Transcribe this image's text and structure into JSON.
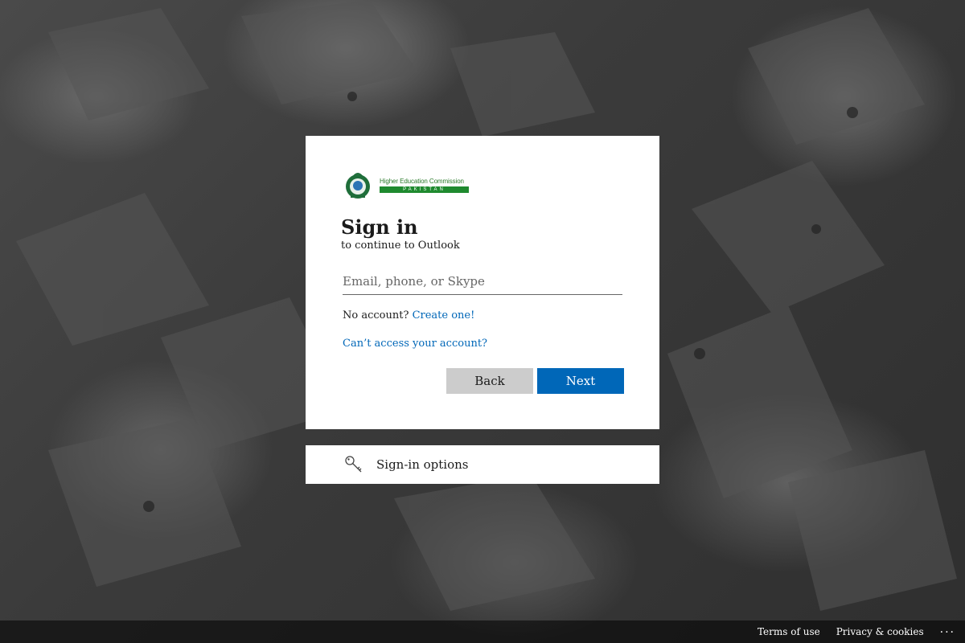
{
  "logo": {
    "line1": "Higher Education Commission",
    "line2": "PAKISTAN"
  },
  "signin": {
    "title": "Sign in",
    "subtitle": "to continue to Outlook",
    "email_placeholder": "Email, phone, or Skype",
    "no_account_text": "No account?",
    "create_link": "Create one!",
    "cant_access_link": "Can’t access your account?",
    "back_label": "Back",
    "next_label": "Next"
  },
  "options": {
    "label": "Sign-in options"
  },
  "footer": {
    "terms": "Terms of use",
    "privacy": "Privacy & cookies",
    "more": "..."
  },
  "colors": {
    "accent": "#0067b8",
    "back_button": "#cccccc",
    "logo_green": "#1f8a2f"
  }
}
